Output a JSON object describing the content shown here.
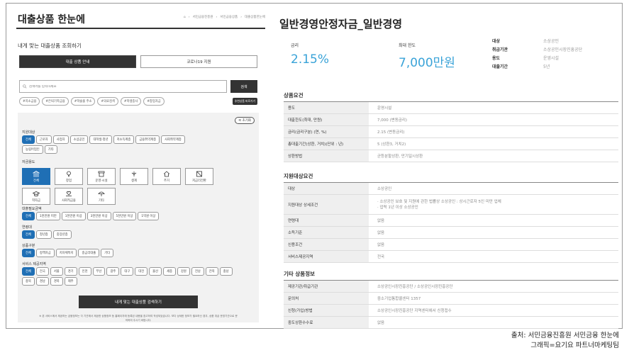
{
  "left": {
    "brand": "대출상품 한눈에",
    "breadcrumbs": [
      "서민금융진흥원",
      "서민금융상품",
      "대출상품한눈에"
    ],
    "subtitle": "내게 맞는 대출상품 조회하기",
    "tabs": [
      {
        "label": "대출 상품 안내",
        "active": true
      },
      {
        "label": "코로나19 지원",
        "active": false
      }
    ],
    "search": {
      "placeholder": "검색어를 입력하세요",
      "button": "검색"
    },
    "tags": [
      "#지소금융",
      "#은퇴기학금융",
      "#학술물 주소",
      "#의료검색",
      "#학생중사",
      "#창업자금"
    ],
    "tags_button": "추천상품 바로가기",
    "reset_label": "초기화",
    "groups": {
      "target": {
        "label": "지원대상",
        "items": [
          "전체",
          "근로자",
          "사업자",
          "소상공인",
          "대학생·청년",
          "저소득계층",
          "금융취약계층",
          "사회취약계층",
          "농림어업인",
          "기타"
        ],
        "selected": 0
      },
      "use": {
        "label": "자금용도",
        "items": [
          "전체",
          "창업",
          "운영·시설",
          "생계",
          "주거",
          "저금리전환",
          "학자금",
          "사회적금융",
          "기타"
        ],
        "icons": [
          "bank-icon",
          "bulb-icon",
          "shop-icon",
          "money-icon",
          "house-icon",
          "exchange-icon",
          "grad-cap-icon",
          "heart-hands-icon",
          "umbrella-icon"
        ],
        "selected": 0
      },
      "amount": {
        "label": "대출필요금액",
        "items": [
          "전체",
          "1천만원 미만",
          "1천만원 이상",
          "3천만원 이상",
          "5천만원 이상",
          "1억원 이상"
        ],
        "selected": 0
      },
      "age": {
        "label": "연령대",
        "items": [
          "전체",
          "청년층",
          "중장년층"
        ],
        "selected": 0
      },
      "type": {
        "label": "상품구분",
        "items": [
          "전체",
          "정책자금",
          "지자체특지",
          "중금리대출",
          "기타"
        ],
        "selected": 0
      },
      "region": {
        "label": "서비스 제공지역",
        "items": [
          "전체",
          "전국",
          "서울",
          "경기",
          "인천",
          "부산",
          "광주",
          "대구",
          "대전",
          "울산",
          "세종",
          "강원",
          "전남",
          "전북",
          "충남",
          "충북",
          "경남",
          "경북",
          "제주"
        ],
        "selected": 0
      }
    },
    "submit_label": "내게 맞는 대출상품 검색하기",
    "notice": "※ 본 서비스에서 제공하는 금융정보는 각 기관에서 제공한 상품정보 등 홈페이지에 등록된 내용을 참고하여 작성되었습니다. 보다 상세한 정보가 필요하신 경우, 상품 취급 운영기관으로 문의하여 주시기 바랍니다."
  },
  "right": {
    "title": "일반경영안정자금_일반경영",
    "rate": {
      "label": "금리",
      "value": "2.15%"
    },
    "limit": {
      "label": "최대 한도",
      "value": "7,000만원"
    },
    "info": [
      {
        "k": "대상",
        "v": "소상공인"
      },
      {
        "k": "취급기관",
        "v": "소상공인시장진흥공단"
      },
      {
        "k": "용도",
        "v": "운영시설"
      },
      {
        "k": "대출기간",
        "v": "5년"
      }
    ],
    "sections": [
      {
        "title": "상품요건",
        "rows": [
          {
            "k": "용도",
            "v": "운영시설"
          },
          {
            "k": "대출한도(최대, 만원)",
            "v": "7,000 (변동금리)"
          },
          {
            "k": "금리(금리구분) (연, %)",
            "v": "2.15 (변동금리)"
          },
          {
            "k": "총대출기간(상환, 거치)(단위 : 년)",
            "v": "5 (상환3, 거치2)"
          },
          {
            "k": "상환방법",
            "v": "균등분할상환, 만기일시상환"
          }
        ]
      },
      {
        "title": "지원대상요건",
        "rows": [
          {
            "k": "대상",
            "v": "소상공인"
          },
          {
            "k": "지원대상 상세조건",
            "v": "· 소상공인 보호 및 지원에 관한 법률상 소상공인 : 상시근로자 5인 미만 업체\n· 업력 1년 이상 소상공인"
          },
          {
            "k": "연령대",
            "v": "없음"
          },
          {
            "k": "소득기준",
            "v": "없음"
          },
          {
            "k": "신용조건",
            "v": "없음"
          },
          {
            "k": "서비스제공지역",
            "v": "전국"
          }
        ]
      },
      {
        "title": "기타 상품정보",
        "rows": [
          {
            "k": "제공기관/취급기관",
            "v": "소상공인시장진흥공단 / 소상공인시장진흥공단"
          },
          {
            "k": "문의처",
            "v": "중소기업통합콜센터 1357"
          },
          {
            "k": "신청(가입)방법",
            "v": "소상공인시장진흥공단 지역센터에서 신청접수"
          },
          {
            "k": "중도상환수수료",
            "v": "없음"
          }
        ]
      }
    ]
  },
  "credit": [
    "출처: 서민금융진흥원 서민금융 한눈에",
    "그래픽=요기요 파트너마케팅팀"
  ],
  "colors": {
    "accent": "#1f6fb5",
    "value_blue": "#3aa3d8",
    "dark": "#333333"
  }
}
